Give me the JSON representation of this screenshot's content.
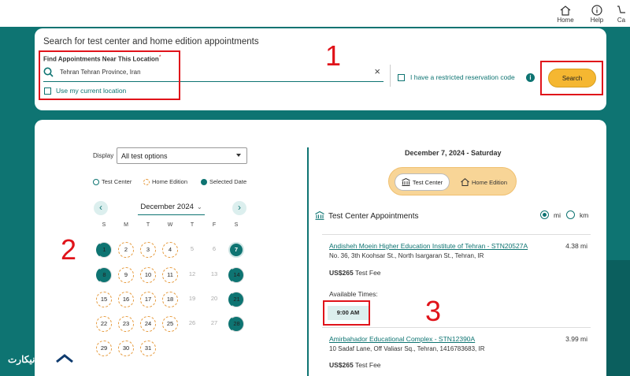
{
  "nav": {
    "home": "Home",
    "help": "Help",
    "cart": "Ca"
  },
  "search": {
    "title": "Search for test center and home edition appointments",
    "find_label": "Find Appointments Near This Location",
    "required_mark": "*",
    "location_value": "Tehran Tehran Province, Iran",
    "use_current_location": "Use my current location",
    "restricted_code": "I have a restricted reservation code",
    "search_button": "Search"
  },
  "filters": {
    "display_label": "Display",
    "display_value": "All test options",
    "legend": {
      "test_center": "Test Center",
      "home_edition": "Home Edition",
      "selected_date": "Selected Date"
    }
  },
  "calendar": {
    "month": "December 2024",
    "weekdays": [
      "S",
      "M",
      "T",
      "W",
      "T",
      "F",
      "S"
    ],
    "days": [
      "1",
      "2",
      "3",
      "4",
      "5",
      "6",
      "7",
      "8",
      "9",
      "10",
      "11",
      "12",
      "13",
      "14",
      "15",
      "16",
      "17",
      "18",
      "19",
      "20",
      "21",
      "22",
      "23",
      "24",
      "25",
      "26",
      "27",
      "28",
      "29",
      "30",
      "31"
    ]
  },
  "results": {
    "date_heading": "December 7, 2024 - Saturday",
    "toggle_test_center": "Test Center",
    "toggle_home_edition": "Home Edition",
    "section_title": "Test Center Appointments",
    "unit_mi": "mi",
    "unit_km": "km",
    "centers": [
      {
        "name": "Andisheh Moein Higher Education Institute of Tehran - STN20527A",
        "distance": "4.38 mi",
        "address": "No. 36, 3th Koohsar St., North Isargaran St., Tehran, IR",
        "fee_amount": "US$265",
        "fee_label": "Test Fee"
      },
      {
        "name": "Amirbahador Educational Complex - STN12390A",
        "distance": "3.99 mi",
        "address": "10 Sadaf Lane, Off Valiasr Sq., Tehran, 1416783683, IR",
        "fee_amount": "US$265",
        "fee_label": "Test Fee"
      }
    ],
    "available_times_label": "Available Times:",
    "times": [
      "9:00 AM"
    ]
  },
  "annotations": {
    "n1": "1",
    "n2": "2",
    "n3": "3"
  },
  "logo": {
    "text": "ایرانیکارت"
  },
  "colors": {
    "teal": "#0e7472",
    "accent": "#f5b731",
    "annotation_red": "#e0131a"
  }
}
